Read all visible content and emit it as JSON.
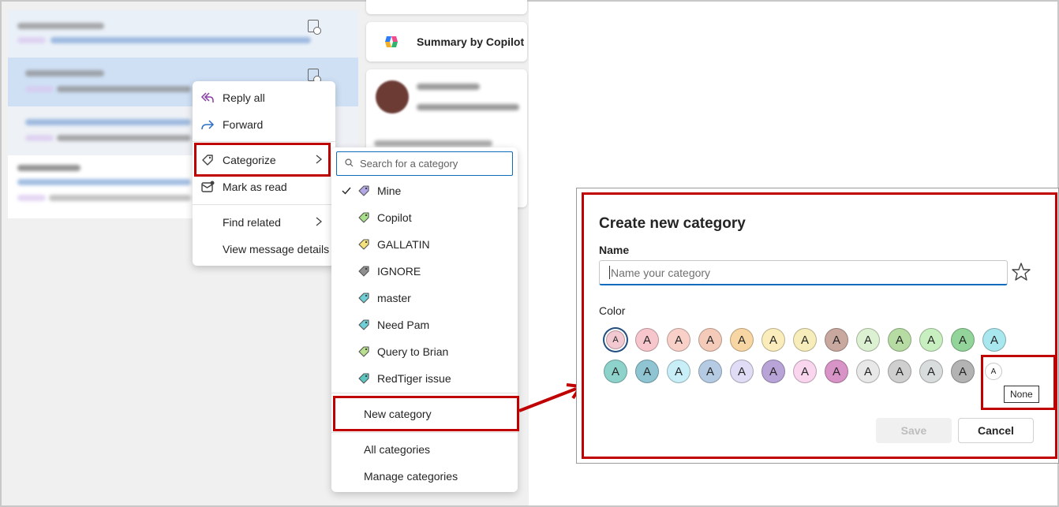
{
  "context_menu": {
    "items": [
      {
        "label": "Reply all",
        "icon": "reply-all-icon"
      },
      {
        "label": "Forward",
        "icon": "forward-icon"
      },
      {
        "label": "Categorize",
        "icon": "tag-icon"
      },
      {
        "label": "Mark as read",
        "icon": "mark-read-icon"
      },
      {
        "label": "Find related"
      },
      {
        "label": "View message details"
      }
    ]
  },
  "copilot_card": {
    "label": "Summary by Copilot"
  },
  "category_menu": {
    "search_placeholder": "Search for a category",
    "categories": [
      {
        "label": "Mine",
        "color": "#b4a7e6",
        "checked": true
      },
      {
        "label": "Copilot",
        "color": "#a8e08c"
      },
      {
        "label": "GALLATIN",
        "color": "#f5e27a"
      },
      {
        "label": "IGNORE",
        "color": "#8f8f8f"
      },
      {
        "label": "master",
        "color": "#6ed0d6"
      },
      {
        "label": "Need Pam",
        "color": "#6ed0d6"
      },
      {
        "label": "Query to Brian",
        "color": "#b8e08f"
      },
      {
        "label": "RedTiger issue",
        "color": "#5cc6c0"
      }
    ],
    "new_category": "New category",
    "all_categories": "All categories",
    "manage_categories": "Manage categories"
  },
  "dialog": {
    "title": "Create new category",
    "name_label": "Name",
    "name_placeholder": "Name your category",
    "color_label": "Color",
    "swatch_letter": "A",
    "colors_row1": [
      "#f2c9d1",
      "#f7c6cc",
      "#f9d0c8",
      "#f4cbb9",
      "#f8d6a3",
      "#fbecbb",
      "#f7edbb",
      "#c9a89f",
      "#dcf1d1",
      "#b6dca3",
      "#c8efc0",
      "#93d49a",
      "#a9e7ee"
    ],
    "colors_row2": [
      "#8ed2cc",
      "#8fc4d2",
      "#c8eef8",
      "#b5cbe3",
      "#e1dcf5",
      "#b9a4d8",
      "#f9d5ee",
      "#d893c7",
      "#e8e8e8",
      "#cfcfcf",
      "#d9dcdc",
      "#b3b3b3"
    ],
    "none_swatch_letter": "A",
    "none_tooltip": "None",
    "save_label": "Save",
    "cancel_label": "Cancel"
  },
  "colors": {
    "highlight": "#c00000",
    "accent": "#0f6cbd"
  }
}
